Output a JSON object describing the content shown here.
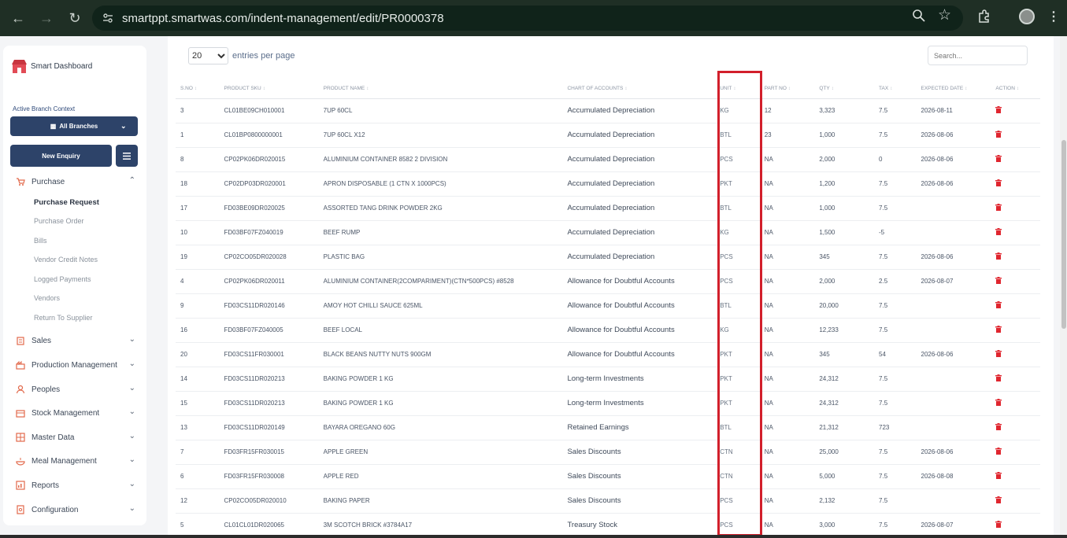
{
  "browser": {
    "url": "smartppt.smartwas.com/indent-management/edit/PR0000378"
  },
  "sidebar": {
    "brand": "Smart Dashboard",
    "context_label": "Active Branch Context",
    "branch_selector": "All Branches",
    "new_enquiry": "New Enquiry",
    "menu": [
      {
        "label": "Purchase",
        "icon": "cart-icon",
        "expanded": true
      },
      {
        "label": "Sales",
        "icon": "sales-icon"
      },
      {
        "label": "Production Management",
        "icon": "production-icon"
      },
      {
        "label": "Peoples",
        "icon": "people-icon"
      },
      {
        "label": "Stock Management",
        "icon": "stock-icon"
      },
      {
        "label": "Master Data",
        "icon": "master-data-icon"
      },
      {
        "label": "Meal Management",
        "icon": "meal-icon"
      },
      {
        "label": "Reports",
        "icon": "reports-icon"
      },
      {
        "label": "Configuration",
        "icon": "configuration-icon"
      }
    ],
    "purchase_sub": [
      "Purchase Request",
      "Purchase Order",
      "Bills",
      "Vendor Credit Notes",
      "Logged Payments",
      "Vendors",
      "Return To Supplier"
    ]
  },
  "table_controls": {
    "entries_value": "20",
    "entries_label": "entries per page",
    "search_placeholder": "Search..."
  },
  "table": {
    "headers": [
      "S.NO",
      "PRODUCT SKU",
      "PRODUCT NAME",
      "CHART OF ACCOUNTS",
      "UNIT",
      "PART NO",
      "QTY",
      "TAX",
      "EXPECTED DATE",
      "ACTION"
    ],
    "rows": [
      [
        "3",
        "CL01BE09CH010001",
        "7UP 60CL",
        "Accumulated Depreciation",
        "KG",
        "12",
        "3,323",
        "7.5",
        "2026-08-11"
      ],
      [
        "1",
        "CL01BP0800000001",
        "7UP 60CL X12",
        "Accumulated Depreciation",
        "BTL",
        "23",
        "1,000",
        "7.5",
        "2026-08-06"
      ],
      [
        "8",
        "CP02PK06DR020015",
        "ALUMINIUM CONTAINER 8582 2 DIVISION",
        "Accumulated Depreciation",
        "PCS",
        "NA",
        "2,000",
        "0",
        "2026-08-06"
      ],
      [
        "18",
        "CP02DP03DR020001",
        "APRON DISPOSABLE (1 CTN X 1000PCS)",
        "Accumulated Depreciation",
        "PKT",
        "NA",
        "1,200",
        "7.5",
        "2026-08-06"
      ],
      [
        "17",
        "FD03BE09DR020025",
        "ASSORTED TANG DRINK POWDER 2KG",
        "Accumulated Depreciation",
        "BTL",
        "NA",
        "1,000",
        "7.5",
        ""
      ],
      [
        "10",
        "FD03BF07FZ040019",
        "BEEF RUMP",
        "Accumulated Depreciation",
        "KG",
        "NA",
        "1,500",
        "-5",
        ""
      ],
      [
        "19",
        "CP02CO05DR020028",
        "PLASTIC BAG",
        "Accumulated Depreciation",
        "PCS",
        "NA",
        "345",
        "7.5",
        "2026-08-06"
      ],
      [
        "4",
        "CP02PK06DR020011",
        "ALUMINIUM CONTAINER(2COMPARIMENT)(CTN*500PCS) #8528",
        "Allowance for Doubtful Accounts",
        "PCS",
        "NA",
        "2,000",
        "2.5",
        "2026-08-07"
      ],
      [
        "9",
        "FD03CS11DR020146",
        "AMOY HOT CHILLI SAUCE 625ML",
        "Allowance for Doubtful Accounts",
        "BTL",
        "NA",
        "20,000",
        "7.5",
        ""
      ],
      [
        "16",
        "FD03BF07FZ040005",
        "BEEF LOCAL",
        "Allowance for Doubtful Accounts",
        "KG",
        "NA",
        "12,233",
        "7.5",
        ""
      ],
      [
        "20",
        "FD03CS11FR030001",
        "BLACK BEANS NUTTY NUTS 900GM",
        "Allowance for Doubtful Accounts",
        "PKT",
        "NA",
        "345",
        "54",
        "2026-08-06"
      ],
      [
        "14",
        "FD03CS11DR020213",
        "BAKING POWDER 1 KG",
        "Long-term Investments",
        "PKT",
        "NA",
        "24,312",
        "7.5",
        ""
      ],
      [
        "15",
        "FD03CS11DR020213",
        "BAKING POWDER 1 KG",
        "Long-term Investments",
        "PKT",
        "NA",
        "24,312",
        "7.5",
        ""
      ],
      [
        "13",
        "FD03CS11DR020149",
        "BAYARA OREGANO 60G",
        "Retained Earnings",
        "BTL",
        "NA",
        "21,312",
        "723",
        ""
      ],
      [
        "7",
        "FD03FR15FR030015",
        "APPLE GREEN",
        "Sales Discounts",
        "CTN",
        "NA",
        "25,000",
        "7.5",
        "2026-08-06"
      ],
      [
        "6",
        "FD03FR15FR030008",
        "APPLE RED",
        "Sales Discounts",
        "CTN",
        "NA",
        "5,000",
        "7.5",
        "2026-08-08"
      ],
      [
        "12",
        "CP02CO05DR020010",
        "BAKING PAPER",
        "Sales Discounts",
        "PCS",
        "NA",
        "2,132",
        "7.5",
        ""
      ],
      [
        "5",
        "CL01CL01DR020065",
        "3M SCOTCH BRICK #3784A17",
        "Treasury Stock",
        "PCS",
        "NA",
        "3,000",
        "7.5",
        "2026-08-07"
      ]
    ]
  },
  "colors": {
    "accent": "#2d4369",
    "delete": "#e0262f",
    "highlight": "#d21f2b"
  }
}
